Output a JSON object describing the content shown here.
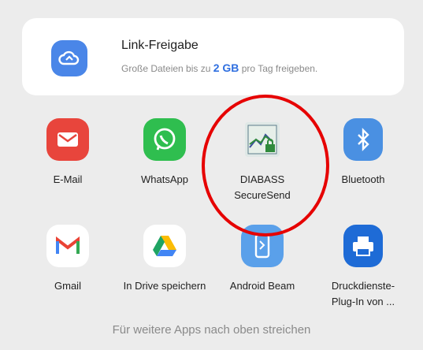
{
  "share_sheet": {
    "link_share": {
      "title": "Link-Freigabe",
      "subtitle_before": "Große Dateien bis zu ",
      "subtitle_size": "2 GB",
      "subtitle_after": " pro Tag freigeben.",
      "icon": "cloud-link-icon"
    },
    "apps": [
      {
        "label": "E-Mail",
        "icon": "email-icon",
        "color": "#e8453c"
      },
      {
        "label": "WhatsApp",
        "icon": "whatsapp-icon",
        "color": "#2fbe4f"
      },
      {
        "label": "DIABASS SecureSend",
        "icon": "diabass-icon",
        "color": "#2f7a4a"
      },
      {
        "label": "Bluetooth",
        "icon": "bluetooth-icon",
        "color": "#4a90e2"
      },
      {
        "label": "Gmail",
        "icon": "gmail-icon",
        "color": "#ea4335"
      },
      {
        "label": "In Drive speichern",
        "icon": "google-drive-icon",
        "color": "#1fa463"
      },
      {
        "label": "Android Beam",
        "icon": "android-beam-icon",
        "color": "#4a90e2"
      },
      {
        "label": "Druckdienste-Plug-In von ...",
        "icon": "print-service-icon",
        "color": "#1e6bd6"
      }
    ],
    "hint": "Für weitere Apps nach oben streichen"
  },
  "annotation": {
    "color": "#e60000",
    "target": "DIABASS SecureSend"
  }
}
